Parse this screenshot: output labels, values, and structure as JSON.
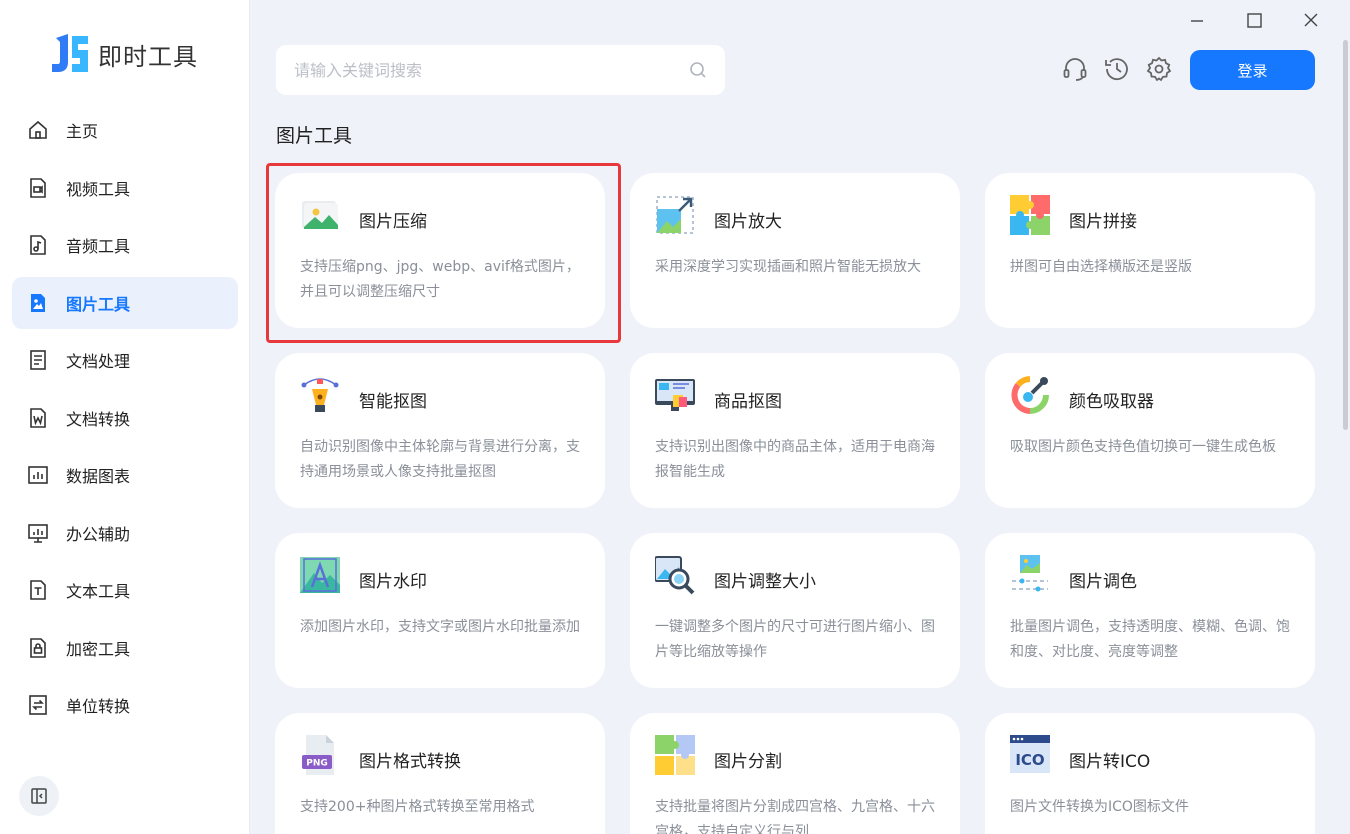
{
  "app": {
    "name": "即时工具"
  },
  "sidebar": {
    "items": [
      {
        "label": "主页",
        "icon": "home-icon"
      },
      {
        "label": "视频工具",
        "icon": "video-icon"
      },
      {
        "label": "音频工具",
        "icon": "audio-icon"
      },
      {
        "label": "图片工具",
        "icon": "image-icon",
        "active": true
      },
      {
        "label": "文档处理",
        "icon": "document-icon"
      },
      {
        "label": "文档转换",
        "icon": "word-icon"
      },
      {
        "label": "数据图表",
        "icon": "chart-icon"
      },
      {
        "label": "办公辅助",
        "icon": "monitor-icon"
      },
      {
        "label": "文本工具",
        "icon": "text-icon"
      },
      {
        "label": "加密工具",
        "icon": "lock-icon"
      },
      {
        "label": "单位转换",
        "icon": "convert-icon"
      }
    ]
  },
  "header": {
    "search_placeholder": "请输入关键词搜索",
    "login_label": "登录"
  },
  "section": {
    "title": "图片工具"
  },
  "cards": [
    {
      "title": "图片压缩",
      "desc": "支持压缩png、jpg、webp、avif格式图片，并且可以调整压缩尺寸",
      "icon": "image-compress-icon"
    },
    {
      "title": "图片放大",
      "desc": "采用深度学习实现插画和照片智能无损放大",
      "icon": "image-enlarge-icon"
    },
    {
      "title": "图片拼接",
      "desc": "拼图可自由选择横版还是竖版",
      "icon": "puzzle-icon"
    },
    {
      "title": "智能抠图",
      "desc": "自动识别图像中主体轮廓与背景进行分离，支持通用场景或人像支持批量抠图",
      "icon": "pen-tool-icon"
    },
    {
      "title": "商品抠图",
      "desc": "支持识别出图像中的商品主体，适用于电商海报智能生成",
      "icon": "shop-icon"
    },
    {
      "title": "颜色吸取器",
      "desc": "吸取图片颜色支持色值切换可一键生成色板",
      "icon": "color-picker-icon"
    },
    {
      "title": "图片水印",
      "desc": "添加图片水印，支持文字或图片水印批量添加",
      "icon": "watermark-icon"
    },
    {
      "title": "图片调整大小",
      "desc": "一键调整多个图片的尺寸可进行图片缩小、图片等比缩放等操作",
      "icon": "image-resize-icon"
    },
    {
      "title": "图片调色",
      "desc": "批量图片调色，支持透明度、模糊、色调、饱和度、对比度、亮度等调整",
      "icon": "image-adjust-icon"
    },
    {
      "title": "图片格式转换",
      "desc": "支持200+种图片格式转换至常用格式",
      "icon": "png-file-icon"
    },
    {
      "title": "图片分割",
      "desc": "支持批量将图片分割成四宫格、九宫格、十六宫格，支持自定义行与列",
      "icon": "split-icon"
    },
    {
      "title": "图片转ICO",
      "desc": "图片文件转换为ICO图标文件",
      "icon": "ico-icon"
    }
  ],
  "colors": {
    "accent": "#1677ff",
    "highlight": "#e7383b",
    "background": "#eff2f9"
  }
}
